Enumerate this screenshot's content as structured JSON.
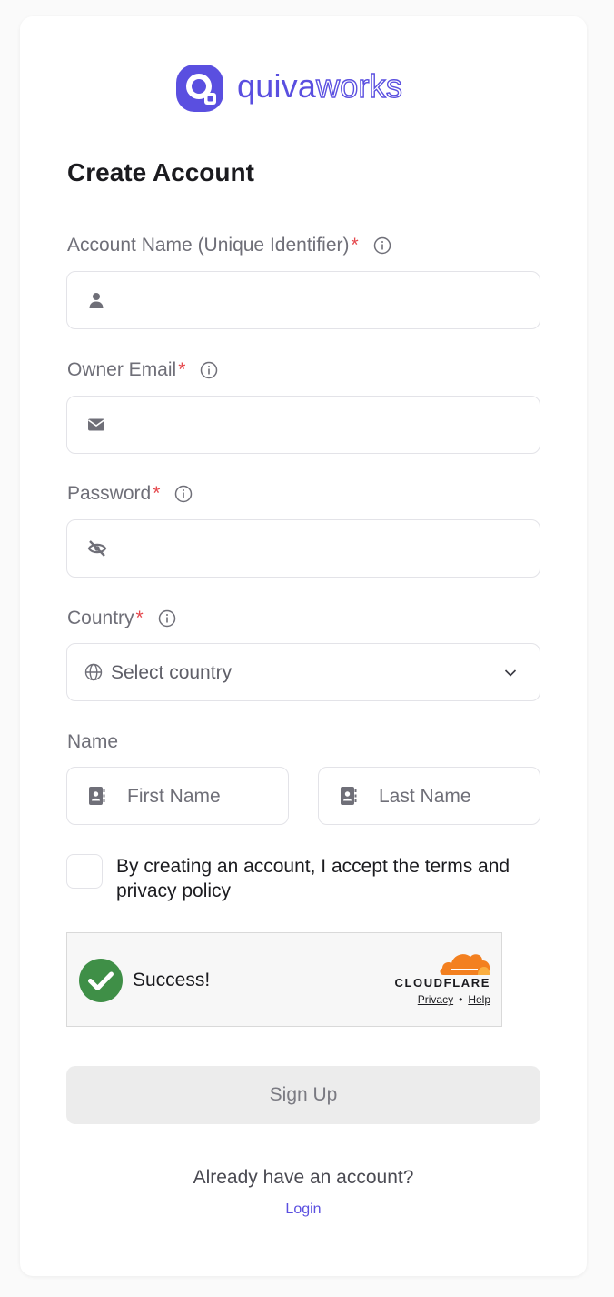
{
  "brand": {
    "name_part1": "quiva",
    "name_part2": "works",
    "accent_color": "#5a4fe0"
  },
  "form": {
    "title": "Create Account",
    "account_name": {
      "label": "Account Name (Unique Identifier)",
      "required_mark": "*",
      "icon": "user-icon",
      "value": ""
    },
    "owner_email": {
      "label": "Owner Email",
      "required_mark": "*",
      "icon": "envelope-icon",
      "value": ""
    },
    "password": {
      "label": "Password",
      "required_mark": "*",
      "icon": "eye-slash-icon",
      "value": ""
    },
    "country": {
      "label": "Country",
      "required_mark": "*",
      "icon": "globe-icon",
      "selected": "Select country"
    },
    "name": {
      "label": "Name",
      "first_placeholder": "First Name",
      "last_placeholder": "Last Name"
    },
    "terms": {
      "checked": false,
      "text": "By creating an account, I accept the terms and privacy policy"
    }
  },
  "captcha": {
    "status": "Success!",
    "provider": "CLOUDFLARE",
    "privacy_link": "Privacy",
    "separator": "•",
    "help_link": "Help",
    "success_color": "#3f8f47",
    "cloud_color": "#f38020"
  },
  "actions": {
    "signup_label": "Sign Up",
    "already_text": "Already have an account?",
    "login_label": "Login"
  }
}
